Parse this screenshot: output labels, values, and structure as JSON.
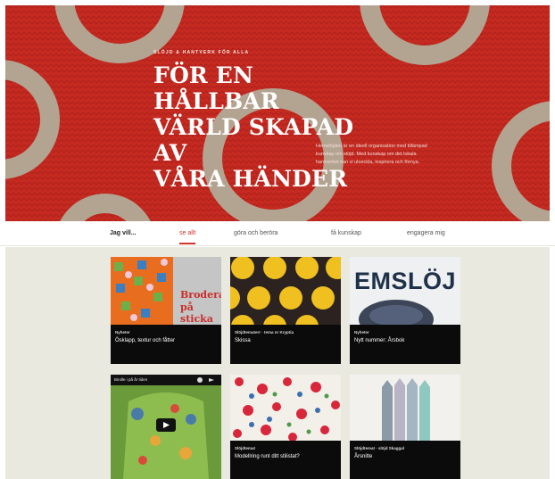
{
  "hero": {
    "kicker": "SLÖJD & HANTVERK FÖR ALLA",
    "title_lines": [
      "FÖR EN HÅLLBAR",
      "VÄRLD SKAPAD AV",
      "VÅRA HÄNDER"
    ],
    "body": "Hemslöjden är en ideell organisation med tillämpad kunskap om slöjd. Med kunskap om det lokala hantverket kan vi utveckla, inspirera och förnya."
  },
  "nav": {
    "label": "Jag vill...",
    "items": [
      {
        "label": "se allt",
        "active": true
      },
      {
        "label": "göra och beröra",
        "active": false
      },
      {
        "label": "få kunskap",
        "active": false
      },
      {
        "label": "engagera mig",
        "active": false
      }
    ]
  },
  "cards": [
    {
      "category": "Nyheter",
      "title": "Ösklapp, textur och fåtter",
      "image": "embroidery-book",
      "book_text": [
        "Brodera",
        "på sticka"
      ]
    },
    {
      "category": "Slöjdtematerr · tema nr Kryptia",
      "title": "Skissa",
      "image": "yellow-dots"
    },
    {
      "category": "Nyheter",
      "title": "Nytt nummer: Årsbok",
      "image": "emslojd-magazine",
      "magazine_text": "EMSLÖJ"
    },
    {
      "category": "",
      "title": "",
      "image": "video-felt-jacket",
      "video_label": "Birolle i på år tiden",
      "video_icon": "play-icon"
    },
    {
      "category": "Slöjdtemat",
      "title": "Modellring runt ditt stilistat?",
      "image": "floral-fabric"
    },
    {
      "category": "Slöjdtemat · slöjd Skaggal",
      "title": "Årsnitte",
      "image": "pastel-fabrics"
    }
  ]
}
